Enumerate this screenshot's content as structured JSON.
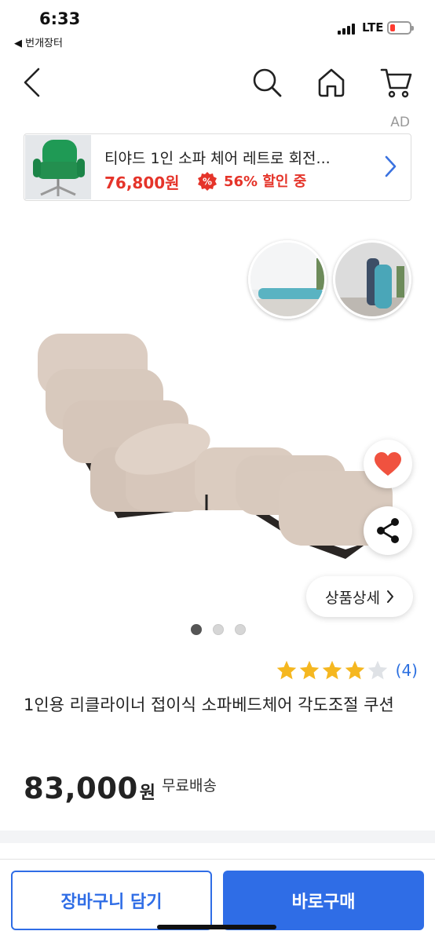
{
  "status_bar": {
    "time": "6:33",
    "back_app": "◀ 번개장터",
    "network": "LTE"
  },
  "nav": {
    "back_icon": "chevron-left-icon",
    "search_icon": "search-icon",
    "home_icon": "home-icon",
    "cart_icon": "cart-icon"
  },
  "ad": {
    "label": "AD",
    "title": "티야드 1인 소파 체어 레트로 회전...",
    "price": "76,800원",
    "badge_symbol": "%",
    "discount": "56% 할인 중",
    "accent_color": "#e5342a"
  },
  "product": {
    "image_count": 3,
    "active_image": 1,
    "detail_button": "상품상세",
    "rating": {
      "stars": 4,
      "max_stars": 5,
      "count": "(4)"
    },
    "title": "1인용 리클라이너 접이식 소파베드체어 각도조절 쿠션",
    "price_value": "83,000",
    "price_unit": "원",
    "shipping": "무료배송"
  },
  "actions": {
    "add_to_cart": "장바구니 담기",
    "buy_now": "바로구매",
    "primary_color": "#2f6de6"
  }
}
